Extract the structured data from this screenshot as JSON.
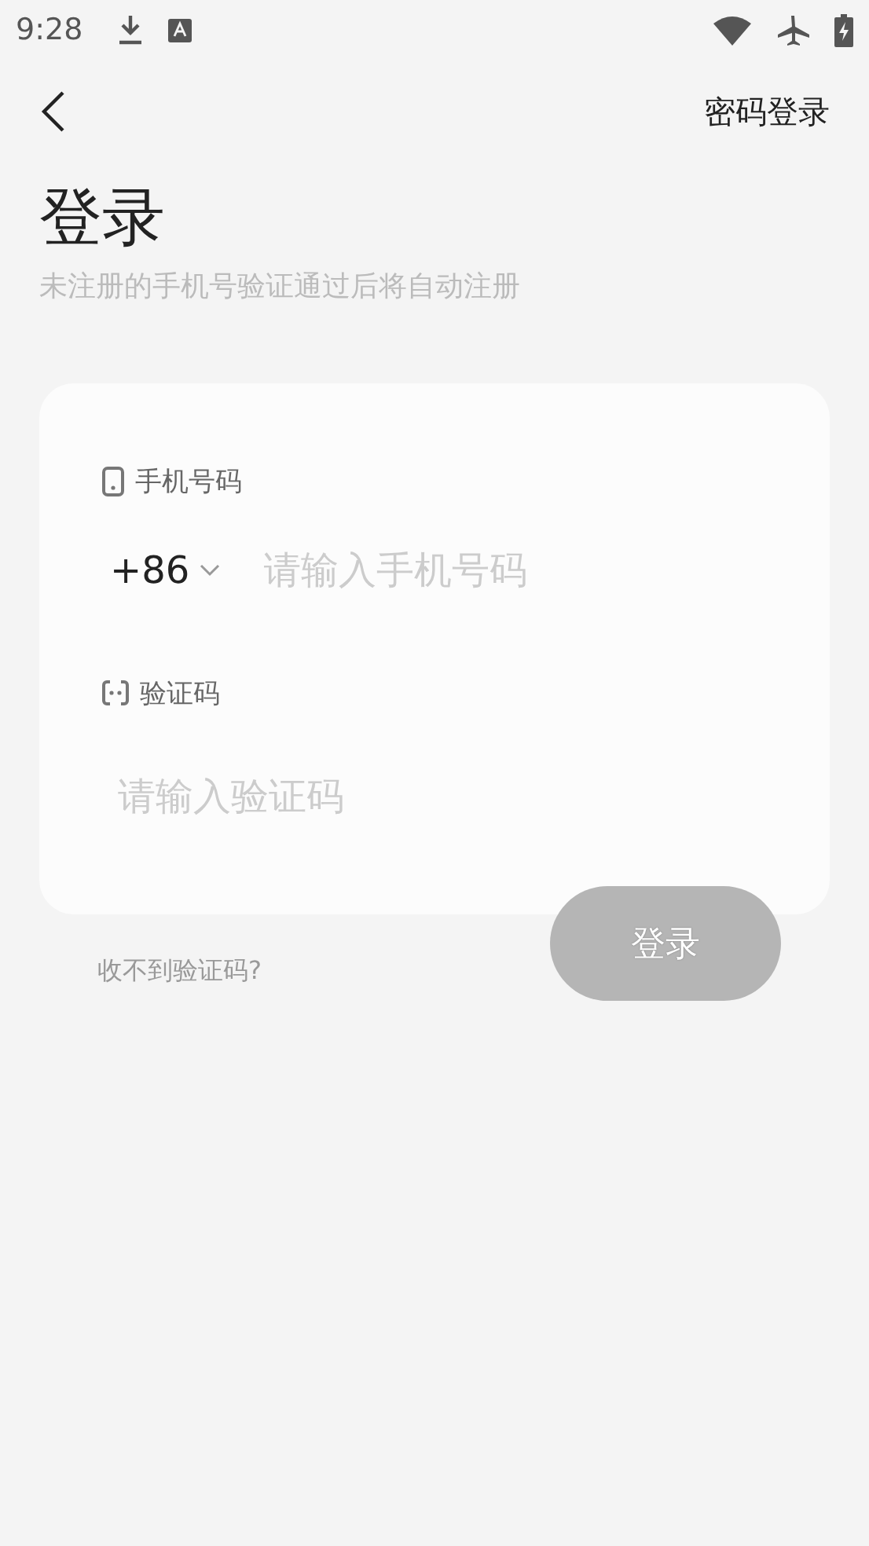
{
  "status_bar": {
    "time": "9:28"
  },
  "header": {
    "switch_link": "密码登录"
  },
  "title": "登录",
  "subtitle": "未注册的手机号验证通过后将自动注册",
  "form": {
    "phone": {
      "label": "手机号码",
      "country_code": "+86",
      "placeholder": "请输入手机号码"
    },
    "code": {
      "label": "验证码",
      "placeholder": "请输入验证码"
    }
  },
  "help_link": "收不到验证码?",
  "login_button": {
    "label": "登录",
    "disabled": true
  }
}
